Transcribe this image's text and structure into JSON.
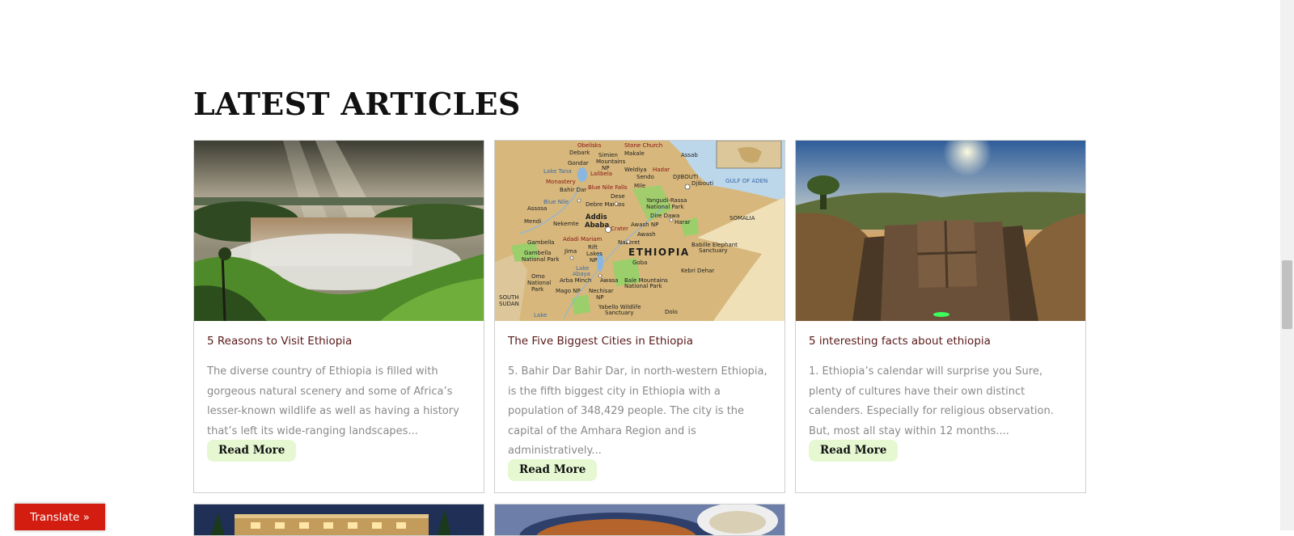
{
  "section": {
    "title": "LATEST ARTICLES"
  },
  "articles": [
    {
      "title": "5 Reasons to Visit Ethiopia",
      "excerpt": "The diverse country of Ethiopia is filled with gorgeous natural scenery and some of Africa’s lesser-known wildlife as well as having a history that’s left its wide-ranging landscapes...",
      "read_more": "Read More",
      "image": "waterfall-photo"
    },
    {
      "title": "The Five Biggest Cities in Ethiopia",
      "excerpt": "5. Bahir Dar Bahir Dar, in north-western Ethiopia, is the fifth biggest city in Ethiopia with a population of 348,429 people. The city is the capital of the Amhara Region and is administratively...",
      "read_more": "Read More",
      "image": "ethiopia-map"
    },
    {
      "title": "5 interesting facts about ethiopia",
      "excerpt": "1. Ethiopia’s calendar will surprise you Sure, plenty of cultures have their own distinct calenders. Especially for religious observation. But, most all stay within 12 months....",
      "read_more": "Read More",
      "image": "rock-church-photo"
    }
  ],
  "map": {
    "country": "ETHIOPIA",
    "labels": [
      "Obelisks",
      "Stone Church",
      "Debark",
      "Simien Mountains NP",
      "Makale",
      "Assab",
      "Gondar",
      "Weldiya",
      "Hadar",
      "Lake Tana",
      "Lalibela",
      "Sendo",
      "DJIBOUTI",
      "Djibouti",
      "GULF OF ADEN",
      "Monastery",
      "Bahir Dar",
      "Mile",
      "Blue Nile Falls",
      "Dese",
      "Blue Nile",
      "Debre Markos",
      "Yangudi-Rassa National Park",
      "Assosa",
      "Addis Ababa",
      "Dire Dawa",
      "Harar",
      "SOMALIA",
      "Mendi",
      "Nekemte",
      "Crater",
      "Awash NP",
      "Awash",
      "Gambella",
      "Adadi Mariam",
      "Nazeret",
      "Babille Elephant Sanctuary",
      "Gambella National Park",
      "Jima",
      "Rift Lakes NP",
      "Goba",
      "Kebri Dehar",
      "Omo National Park",
      "Arba Minch",
      "Lake Abaya",
      "Awasa",
      "Bale Mountains National Park",
      "SOUTH SUDAN",
      "Mago NP",
      "Nechisar NP",
      "Yabello Wildlife Sanctuary",
      "Lake",
      "Dolo"
    ]
  },
  "translate": {
    "label": "Translate »"
  },
  "colors": {
    "title_accent": "#5a1a1a",
    "button_green": "#e6f8d2",
    "translate_red": "#d21d10"
  }
}
